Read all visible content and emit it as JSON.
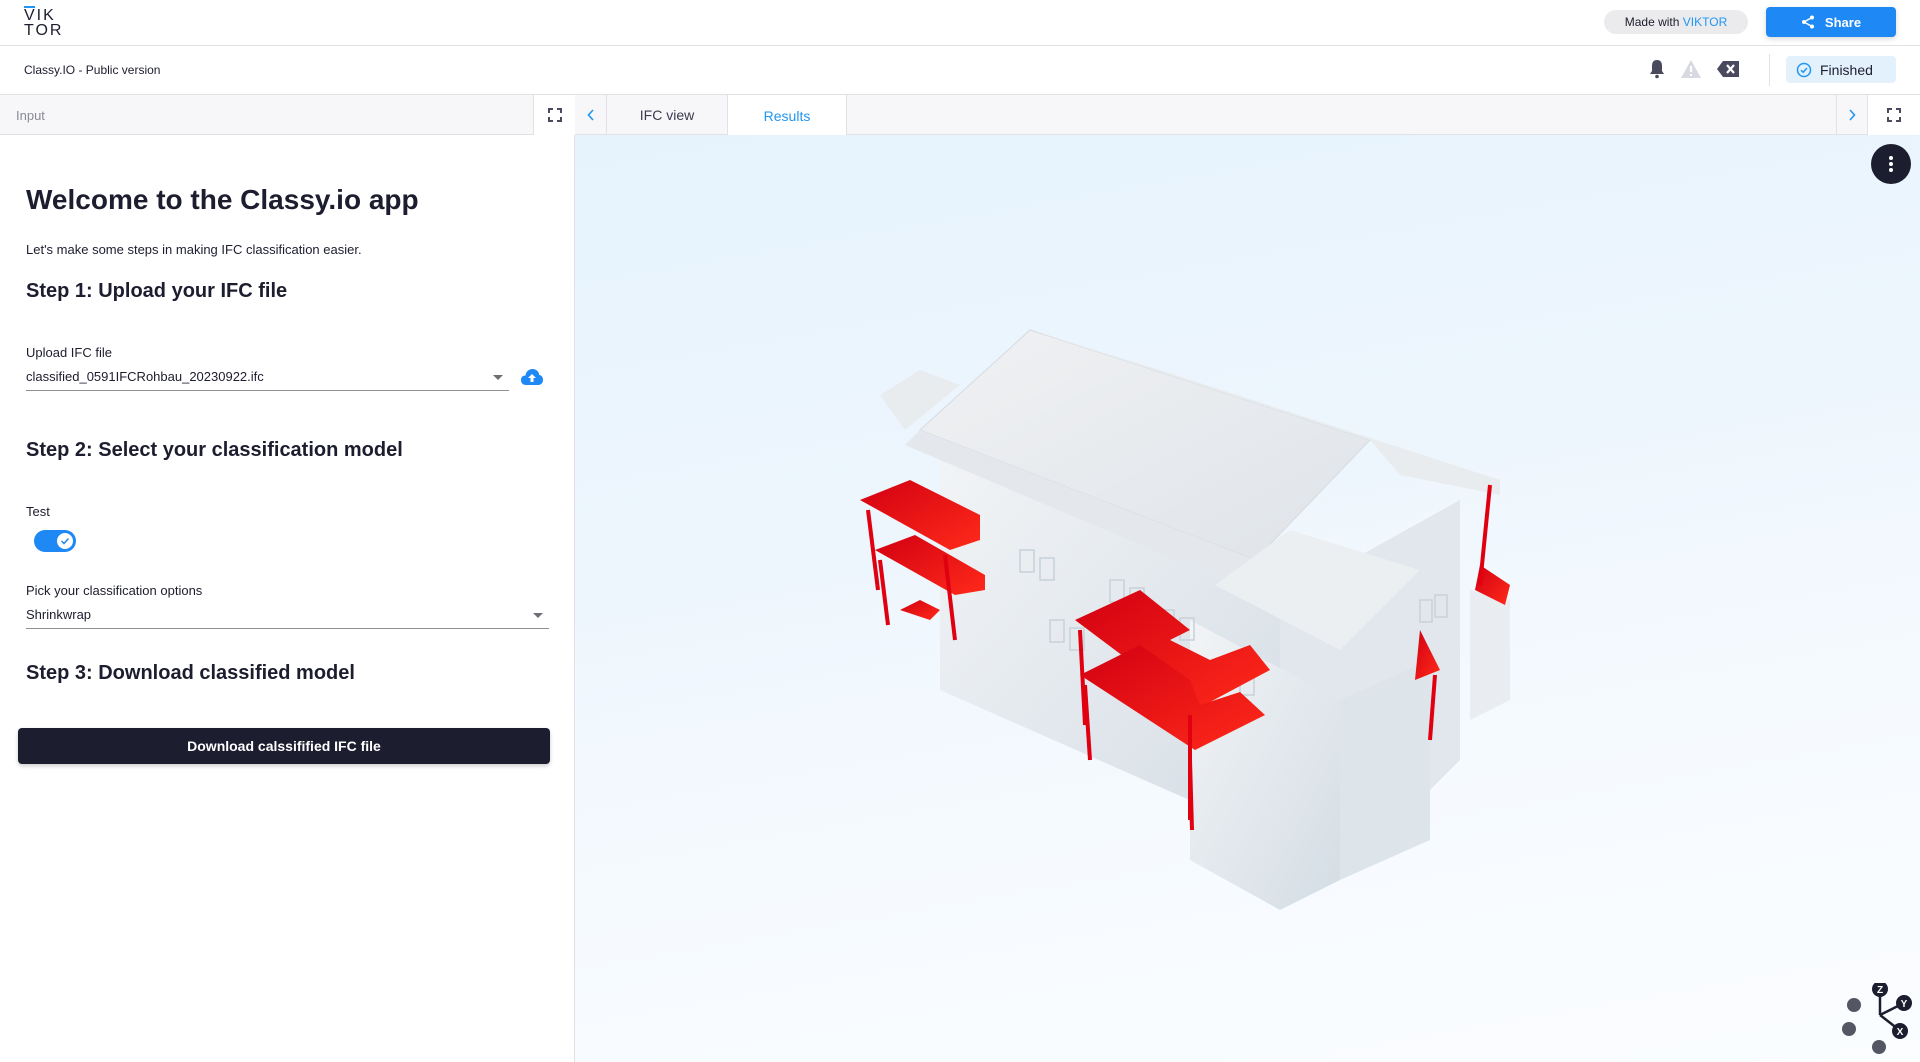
{
  "topbar": {
    "logo_line1": "VIK",
    "logo_line2": "TOR",
    "made_with_prefix": "Made with ",
    "made_with_brand": "VIKTOR",
    "share_label": "Share"
  },
  "subbar": {
    "app_title": "Classy.IO - Public version",
    "icons": [
      "bell-icon",
      "warning-icon",
      "clear-icon"
    ],
    "status": "Finished"
  },
  "left_panel": {
    "header_title": "Input",
    "title": "Welcome to the Classy.io app",
    "intro": "Let's make some steps in making IFC classification easier.",
    "step1": {
      "heading": "Step 1: Upload your IFC file",
      "field_label": "Upload IFC file",
      "value": "classified_0591IFCRohbau_20230922.ifc"
    },
    "step2": {
      "heading": "Step 2: Select your classification model",
      "toggle_label": "Test",
      "toggle_on": true,
      "select_label": "Pick your classification options",
      "select_value": "Shrinkwrap"
    },
    "step3": {
      "heading": "Step 3: Download classified model",
      "button_label": "Download calssifified IFC file"
    }
  },
  "right_panel": {
    "tabs": [
      {
        "label": "IFC view",
        "active": false
      },
      {
        "label": "Results",
        "active": true
      }
    ],
    "viewer": {
      "highlight_color": "#e8000b",
      "model_color": "#e4eaef",
      "axes": [
        "Z",
        "Y",
        "X"
      ]
    }
  },
  "colors": {
    "accent": "#1e88f5",
    "dark": "#1c1d2e",
    "status_bg": "#e3f1fd"
  }
}
